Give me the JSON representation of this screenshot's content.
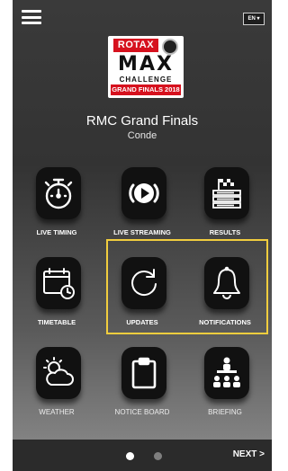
{
  "header": {
    "menu_icon": "hamburger-icon",
    "language": "EN ▾"
  },
  "logo": {
    "brand": "ROTAX",
    "line1": "MAX",
    "line2": "CHALLENGE",
    "line3": "GRAND FINALS 2018"
  },
  "event": {
    "title": "RMC Grand Finals",
    "location": "Conde"
  },
  "tiles": [
    {
      "label": "LIVE TIMING",
      "icon": "stopwatch-icon"
    },
    {
      "label": "LIVE STREAMING",
      "icon": "play-icon"
    },
    {
      "label": "RESULTS",
      "icon": "results-flag-icon"
    },
    {
      "label": "TIMETABLE",
      "icon": "calendar-clock-icon"
    },
    {
      "label": "UPDATES",
      "icon": "refresh-icon"
    },
    {
      "label": "NOTIFICATIONS",
      "icon": "bell-icon"
    },
    {
      "label": "WEATHER",
      "icon": "weather-icon"
    },
    {
      "label": "NOTICE BOARD",
      "icon": "clipboard-icon"
    },
    {
      "label": "BRIEFING",
      "icon": "briefing-icon"
    }
  ],
  "pagination": {
    "current_page": 1,
    "total_pages": 2
  },
  "footer": {
    "next_label": "NEXT >"
  },
  "colors": {
    "highlight": "#f1cd3e",
    "brand_red": "#d6111e"
  }
}
